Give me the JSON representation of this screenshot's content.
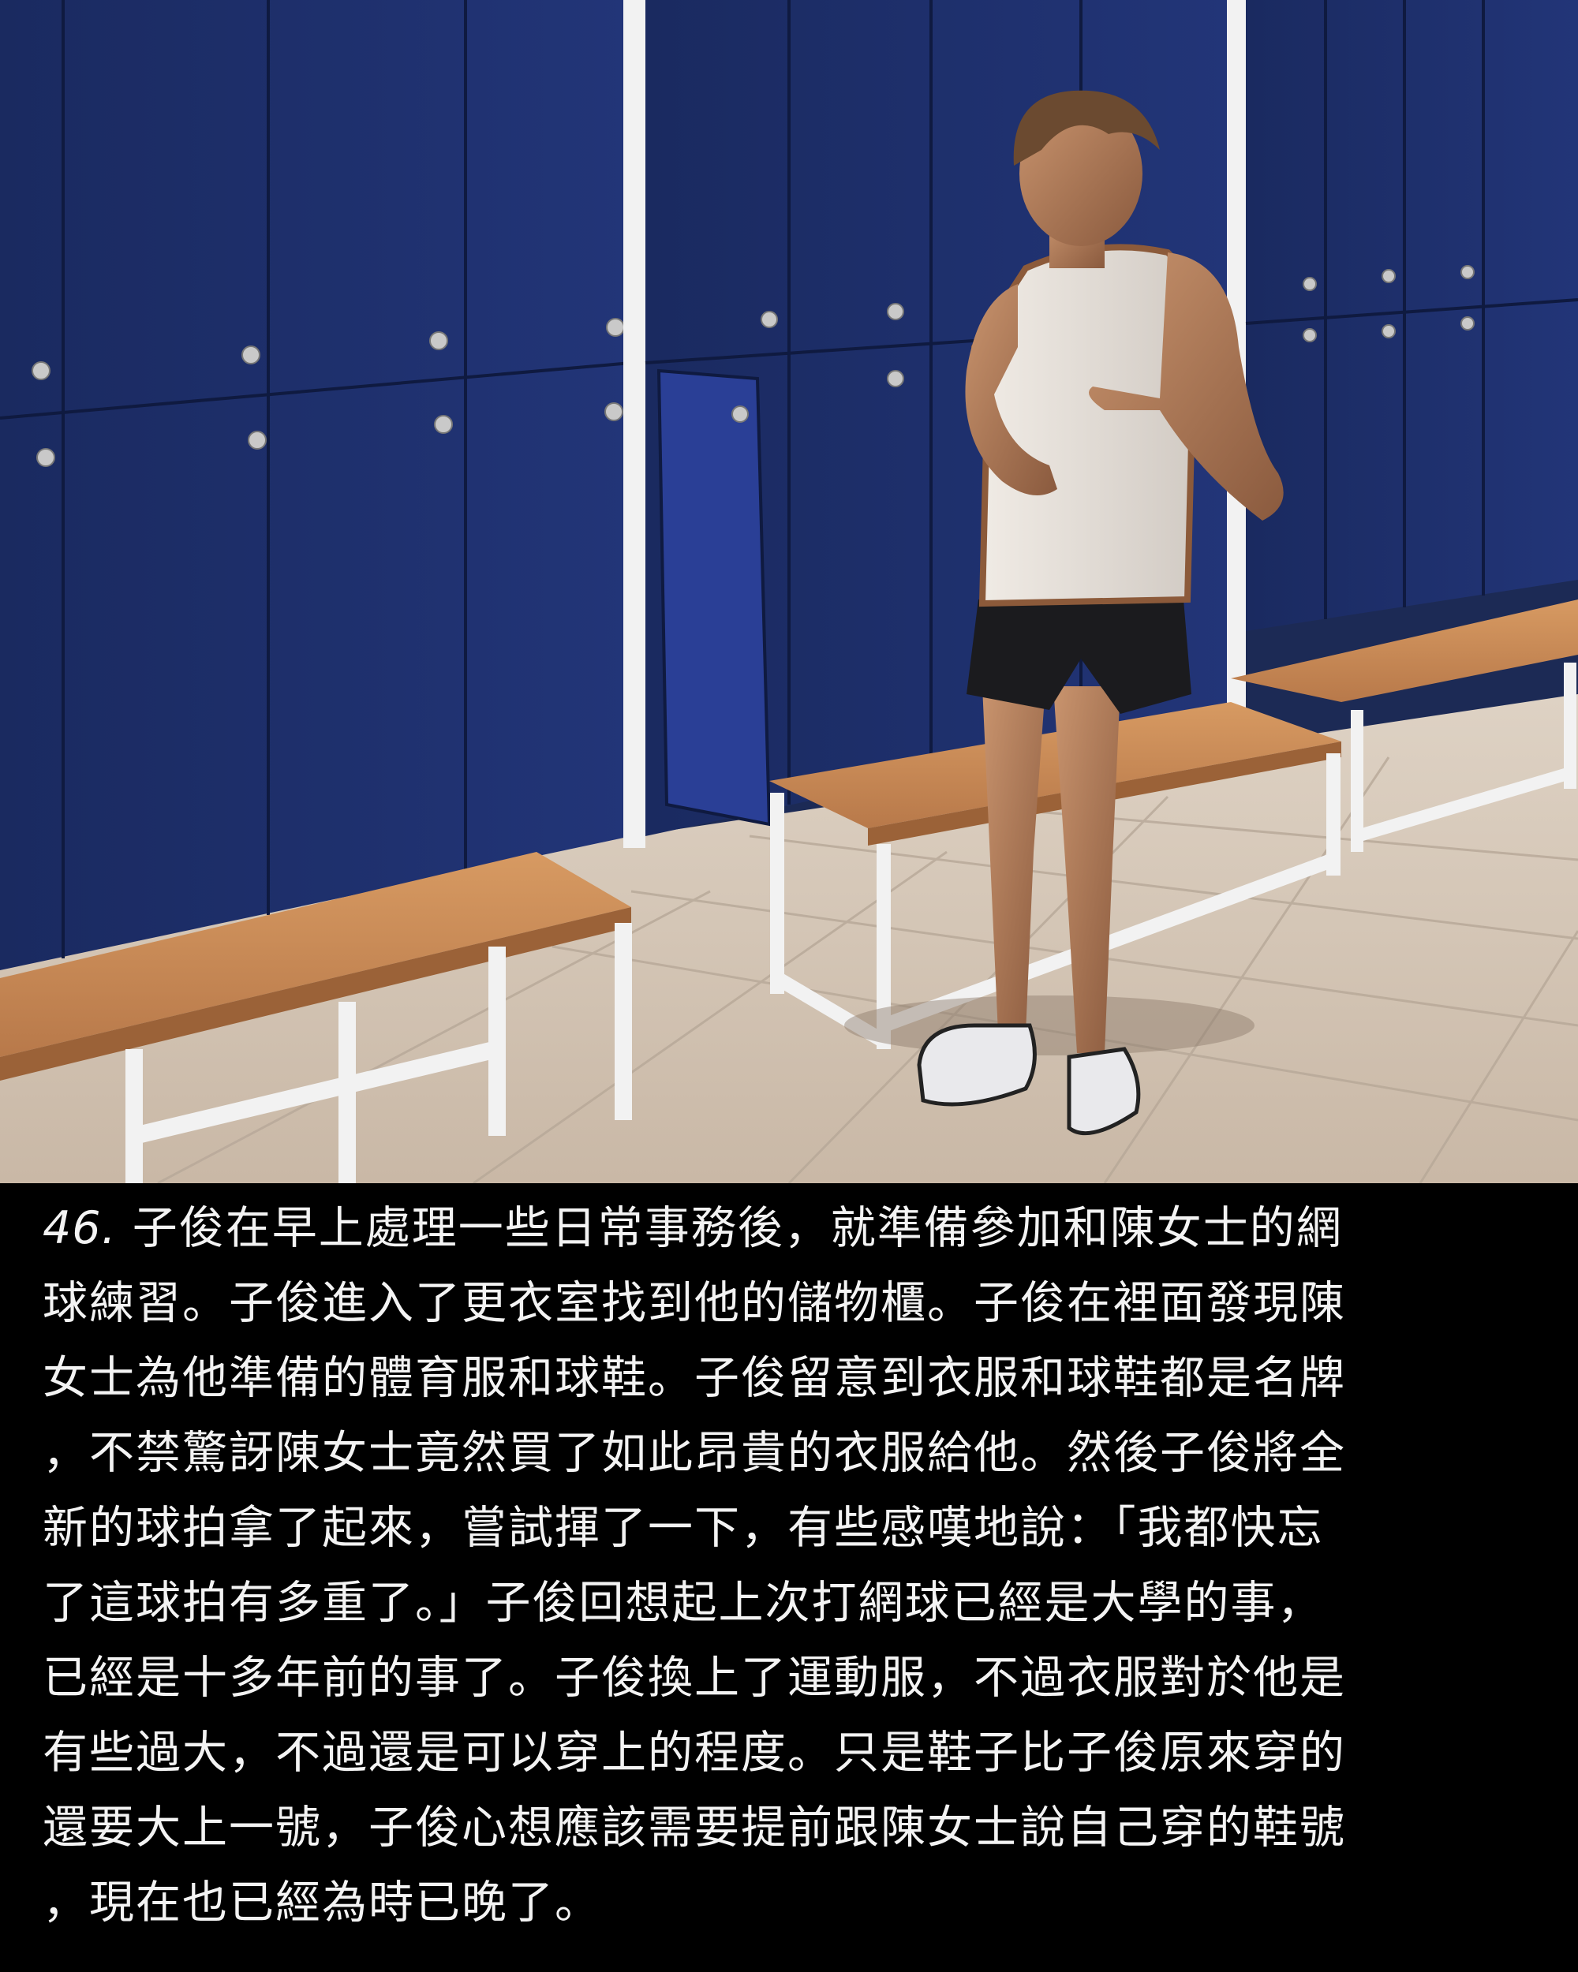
{
  "panel": {
    "number": "46.",
    "text": " 子俊在早上處理一些日常事務後，就準備參加和陳女士的網\n球練習。子俊進入了更衣室找到他的儲物櫃。子俊在裡面發現陳\n女士為他準備的體育服和球鞋。子俊留意到衣服和球鞋都是名牌\n，不禁驚訝陳女士竟然買了如此昂貴的衣服給他。然後子俊將全\n新的球拍拿了起來，嘗試揮了一下，有些感嘆地說：「我都快忘\n了這球拍有多重了。」子俊回想起上次打網球已經是大學的事，\n已經是十多年前的事了。子俊換上了運動服，不過衣服對於他是\n有些過大，不過還是可以穿上的程度。只是鞋子比子俊原來穿的\n還要大上一號，子俊心想應該需要提前跟陳女士說自己穿的鞋號\n，現在也已經為時已晚了。"
  },
  "colors": {
    "locker": "#1f2f6a",
    "locker_dark": "#172453",
    "frame": "#f2f2f2",
    "bench": "#c88a55",
    "floor": "#d9cbbb",
    "caption_bg": "#000000",
    "caption_text": "#f3f3f3"
  }
}
